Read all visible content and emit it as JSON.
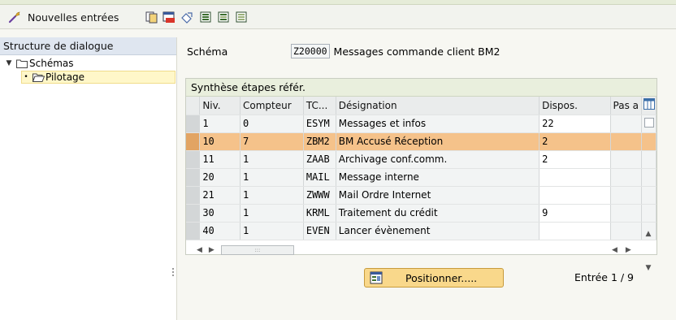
{
  "toolbar": {
    "new_entries_label": "Nouvelles entrées",
    "icons": [
      "tool-icon",
      "copy-icon",
      "delete-icon",
      "undo-icon",
      "select-all-icon",
      "select-block-icon",
      "deselect-all-icon"
    ]
  },
  "sidebar": {
    "title": "Structure de dialogue",
    "tree": [
      {
        "label": "Schémas",
        "level": 0,
        "expanded": true
      },
      {
        "label": "Pilotage",
        "level": 1,
        "selected": true
      }
    ]
  },
  "schema": {
    "label": "Schéma",
    "code": "Z20000",
    "description": "Messages commande client BM2"
  },
  "grid": {
    "title": "Synthèse étapes référ.",
    "columns": [
      "Niv.",
      "Compteur",
      "TC...",
      "Désignation",
      "Dispos.",
      "Pas a"
    ],
    "rows": [
      {
        "niv": "1",
        "compteur": "0",
        "tc": "ESYM",
        "designation": "Messages et infos",
        "dispos": "22",
        "pas": ""
      },
      {
        "niv": "10",
        "compteur": "7",
        "tc": "ZBM2",
        "designation": "BM Accusé Réception",
        "dispos": "2",
        "pas": "",
        "highlighted": true
      },
      {
        "niv": "11",
        "compteur": "1",
        "tc": "ZAAB",
        "designation": "Archivage conf.comm.",
        "dispos": "2",
        "pas": ""
      },
      {
        "niv": "20",
        "compteur": "1",
        "tc": "MAIL",
        "designation": "Message interne",
        "dispos": "",
        "pas": ""
      },
      {
        "niv": "21",
        "compteur": "1",
        "tc": "ZWWW",
        "designation": "Mail Ordre Internet",
        "dispos": "",
        "pas": ""
      },
      {
        "niv": "30",
        "compteur": "1",
        "tc": "KRML",
        "designation": "Traitement du crédit",
        "dispos": "9",
        "pas": ""
      },
      {
        "niv": "40",
        "compteur": "1",
        "tc": "EVEN",
        "designation": "Lancer évènement",
        "dispos": "",
        "pas": ""
      }
    ]
  },
  "footer": {
    "position_button": "Positionner.....",
    "entry_info": "Entrée 1 / 9"
  },
  "colors": {
    "highlight_row": "#f5c28a",
    "button_bg": "#f9d88b",
    "section_header": "#e9efdd"
  }
}
